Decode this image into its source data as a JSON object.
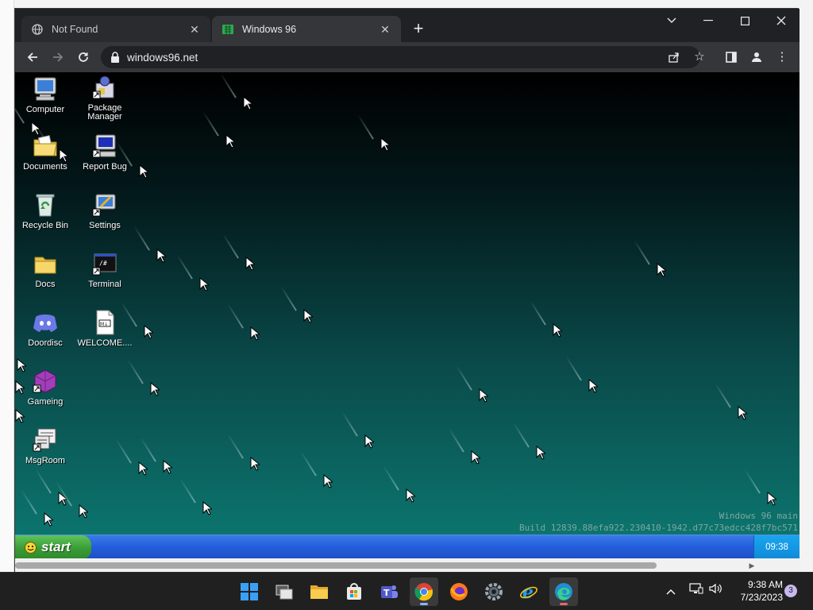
{
  "browser": {
    "tabs": [
      {
        "title": "Not Found",
        "active": false
      },
      {
        "title": "Windows 96",
        "active": true
      }
    ],
    "url": "windows96.net"
  },
  "desktop": {
    "icons": [
      {
        "label": "Computer",
        "icon": "computer-icon"
      },
      {
        "label": "Package Manager",
        "icon": "package-manager-icon"
      },
      {
        "label": "Documents",
        "icon": "documents-icon"
      },
      {
        "label": "Report Bug",
        "icon": "report-bug-icon"
      },
      {
        "label": "Recycle Bin",
        "icon": "recycle-bin-icon"
      },
      {
        "label": "Settings",
        "icon": "settings-icon"
      },
      {
        "label": "Docs",
        "icon": "folder-icon"
      },
      {
        "label": "Terminal",
        "icon": "terminal-icon"
      },
      {
        "label": "Doordisc",
        "icon": "doordisc-icon"
      },
      {
        "label": "WELCOME....",
        "icon": "markdown-file-icon"
      },
      {
        "label": "Gameing",
        "icon": "gameing-icon"
      },
      {
        "label": "MsgRoom",
        "icon": "msgroom-icon"
      }
    ],
    "watermark_line1": "Windows 96 main",
    "watermark_line2": "Build 12839.88efa922.230410-1942.d77c73edcc428f7bc571",
    "start_label": "start",
    "clock": "09:38"
  },
  "os": {
    "time": "9:38 AM",
    "date": "7/23/2023",
    "notification_count": "3"
  },
  "colors": {
    "w96_start_green": "#3a9c36",
    "w96_taskbar_blue": "#245edb",
    "w96_clock_blue": "#0f8ad8"
  }
}
